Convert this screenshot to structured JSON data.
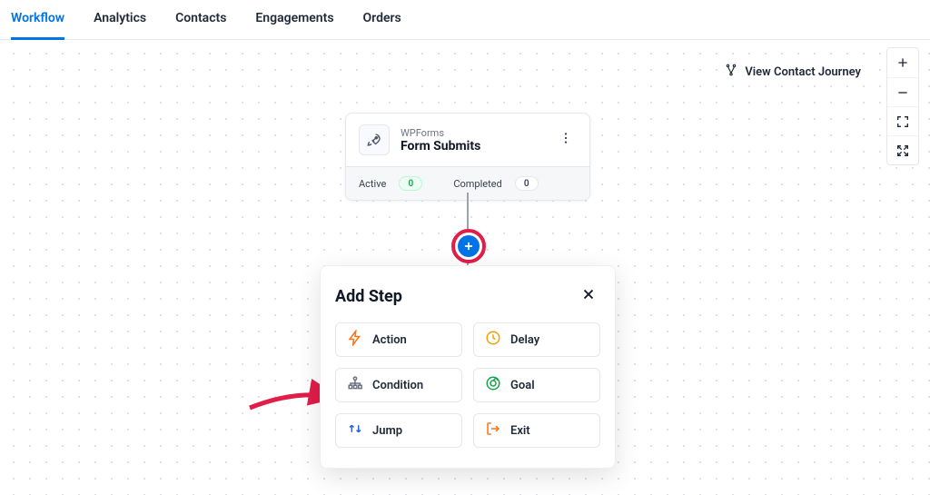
{
  "tabs": {
    "items": [
      {
        "label": "Workflow",
        "active": true
      },
      {
        "label": "Analytics",
        "active": false
      },
      {
        "label": "Contacts",
        "active": false
      },
      {
        "label": "Engagements",
        "active": false
      },
      {
        "label": "Orders",
        "active": false
      }
    ]
  },
  "journey_link": "View Contact Journey",
  "trigger": {
    "provider": "WPForms",
    "title": "Form Submits",
    "stats": {
      "active_label": "Active",
      "active_value": "0",
      "completed_label": "Completed",
      "completed_value": "0"
    }
  },
  "popover": {
    "title": "Add Step",
    "options": [
      {
        "key": "action",
        "label": "Action"
      },
      {
        "key": "delay",
        "label": "Delay"
      },
      {
        "key": "condition",
        "label": "Condition"
      },
      {
        "key": "goal",
        "label": "Goal"
      },
      {
        "key": "jump",
        "label": "Jump"
      },
      {
        "key": "exit",
        "label": "Exit"
      }
    ]
  }
}
